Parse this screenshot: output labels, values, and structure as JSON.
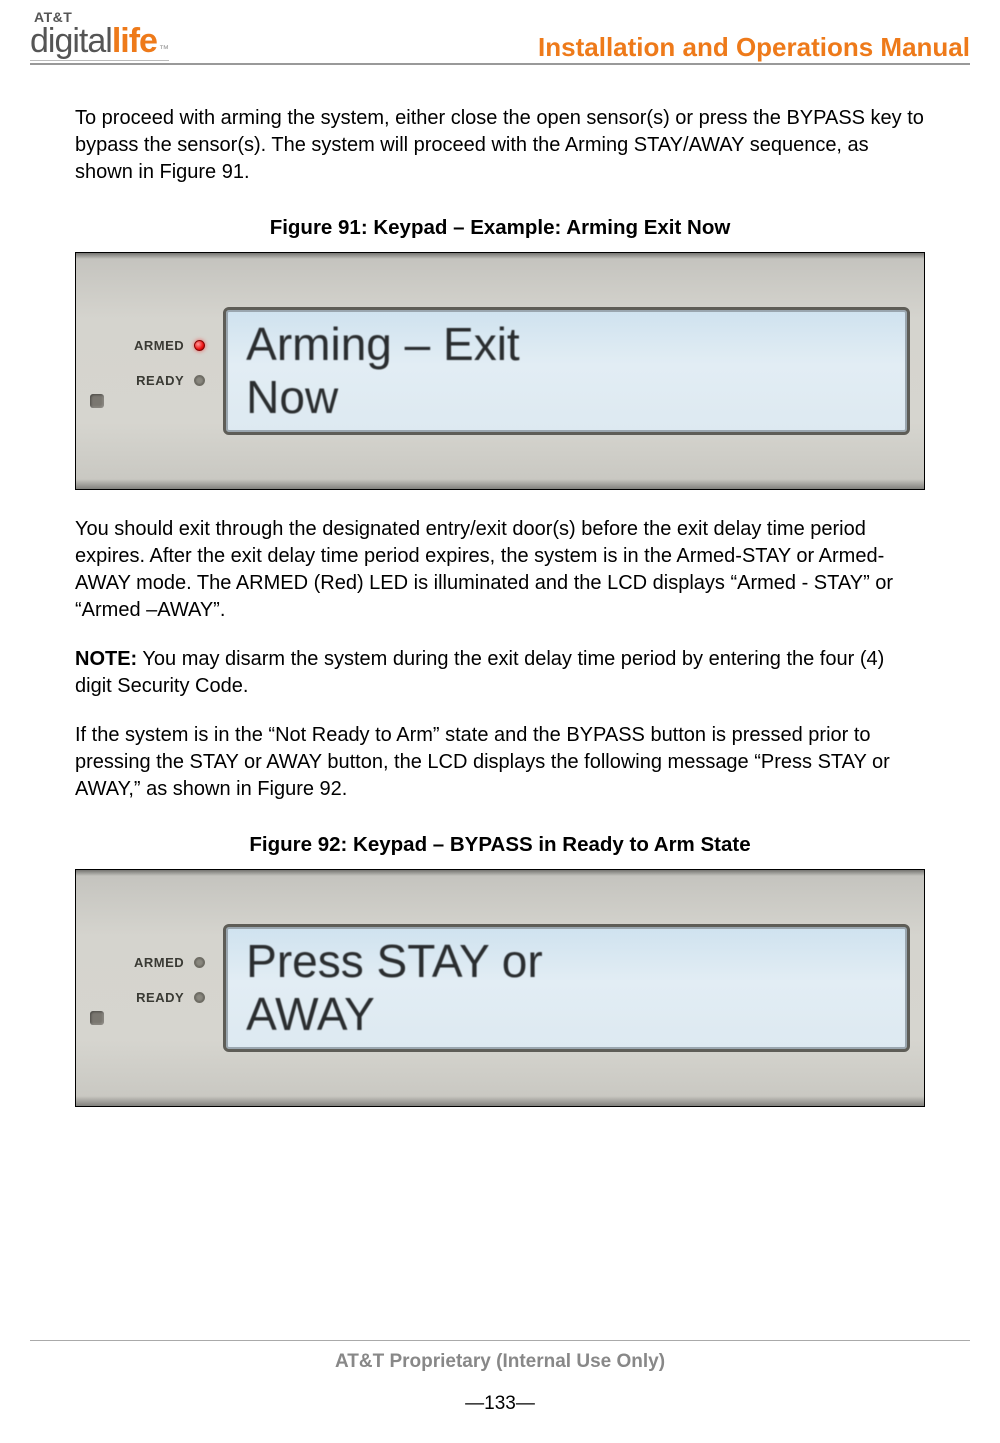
{
  "header": {
    "logo_att": "AT&T",
    "logo_digital": "digital",
    "logo_life": "life",
    "tm": "™",
    "title": "Installation and Operations Manual"
  },
  "paras": {
    "p1": "To proceed with arming the system, either close the open sensor(s) or press the BYPASS key to bypass the sensor(s). The system will proceed with the Arming STAY/AWAY sequence, as shown in Figure 91.",
    "p2": "You should exit through the designated entry/exit door(s) before the exit delay time period expires. After the exit delay time period expires, the system is in the Armed-STAY or Armed-AWAY mode. The ARMED (Red) LED is illuminated and the LCD displays “Armed - STAY” or “Armed –AWAY”.",
    "note_label": "NOTE:",
    "p3_after_note": " You may disarm the system during the exit delay time period by entering the four (4) digit Security Code.",
    "p4": "If the system is in the “Not Ready to Arm” state and the BYPASS button is pressed prior to pressing the STAY or AWAY button, the LCD displays the following message “Press STAY or AWAY,” as shown in Figure 92."
  },
  "figures": {
    "f91": {
      "caption": "Figure 91: Keypad – Example: Arming Exit Now",
      "armed_label": "ARMED",
      "ready_label": "READY",
      "armed_led_on": true,
      "lcd_text": "Arming – Exit\nNow"
    },
    "f92": {
      "caption": "Figure 92: Keypad – BYPASS in Ready to Arm State",
      "armed_label": "ARMED",
      "ready_label": "READY",
      "armed_led_on": false,
      "lcd_text": "Press STAY or\nAWAY"
    }
  },
  "footer": {
    "proprietary": "AT&T Proprietary (Internal Use Only)",
    "page": "—133—"
  }
}
